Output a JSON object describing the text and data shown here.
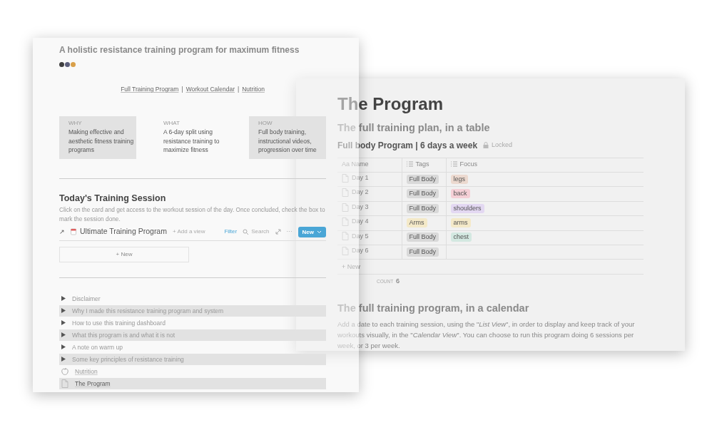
{
  "program_page": {
    "title": "The Program",
    "table_heading": "The full training plan, in a table",
    "database": {
      "title": "Full body Program | 6 days a week",
      "lock": "Locked",
      "columns": [
        {
          "label": "Aa Name",
          "kind": "text"
        },
        {
          "label": "Tags",
          "kind": "list"
        },
        {
          "label": "Focus",
          "kind": "list"
        }
      ],
      "rows": [
        {
          "name": "Day 1",
          "tags": [
            {
              "label": "Full Body",
              "color": "#d9d9d9"
            }
          ],
          "focus": [
            {
              "label": "legs",
              "color": "#ecd9cf"
            }
          ]
        },
        {
          "name": "Day 2",
          "tags": [
            {
              "label": "Full Body",
              "color": "#d9d9d9"
            }
          ],
          "focus": [
            {
              "label": "back",
              "color": "#f5cfd6"
            }
          ]
        },
        {
          "name": "Day 3",
          "tags": [
            {
              "label": "Full Body",
              "color": "#d9d9d9"
            }
          ],
          "focus": [
            {
              "label": "shoulders",
              "color": "#e3d8f2"
            }
          ]
        },
        {
          "name": "Day 4",
          "tags": [
            {
              "label": "Arms",
              "color": "#f4e9c8"
            }
          ],
          "focus": [
            {
              "label": "arms",
              "color": "#f4e9c8"
            }
          ]
        },
        {
          "name": "Day 5",
          "tags": [
            {
              "label": "Full Body",
              "color": "#d9d9d9"
            }
          ],
          "focus": [
            {
              "label": "chest",
              "color": "#d3e8e1"
            }
          ]
        },
        {
          "name": "Day 6",
          "tags": [
            {
              "label": "Full Body",
              "color": "#d9d9d9"
            }
          ],
          "focus": []
        }
      ],
      "new_row": "+ New",
      "count_label": "COUNT",
      "count": "6"
    },
    "calendar_heading": "The full training program, in a calendar",
    "calendar_text": "Add a date to each training session, using the \"*List View*\", in order to display and keep track of your workouts visually, in the \"*Calendar View*\". You can choose to run this program doing 6 sessions per week, or 3 per week."
  },
  "dashboard_page": {
    "subtitle": "A holistic resistance training program for maximum fitness",
    "dots": [
      {
        "color": "#3f3f3f"
      },
      {
        "color": "#5b5e7a"
      },
      {
        "color": "#d9a04a"
      }
    ],
    "links": [
      "Full Training Program",
      "Workout Calendar",
      "Nutrition"
    ],
    "link_separator": "|",
    "columns": [
      {
        "heading": "WHY",
        "text": "Making effective and aesthetic fitness training programs",
        "shaded": true
      },
      {
        "heading": "WHAT",
        "text": "A 6-day split using resistance training to maximize fitness",
        "shaded": false
      },
      {
        "heading": "HOW",
        "text": "Full body training, instructional videos, progression over time",
        "shaded": true
      }
    ],
    "session_heading": "Today's Training Session",
    "session_text": "Click on the card and get access to the workout session of the day. Once concluded, check the box to mark the session done.",
    "view": {
      "arrow": "↗",
      "title": "Ultimate Training Program",
      "add_view": "+ Add a view",
      "filter": "Filter",
      "search": "Search",
      "more": "···",
      "new_button": "New",
      "new_card": "+ New"
    },
    "toggles": [
      {
        "kind": "toggle",
        "label": "Disclaimer",
        "highlighted": false
      },
      {
        "kind": "toggle",
        "label": "Why I made this resistance training program and system",
        "highlighted": true
      },
      {
        "kind": "toggle",
        "label": "How to use this training dashboard",
        "highlighted": false
      },
      {
        "kind": "toggle",
        "label": "What this program is and what it is not",
        "highlighted": true
      },
      {
        "kind": "toggle",
        "label": "A note on warm up",
        "highlighted": false
      },
      {
        "kind": "toggle",
        "label": "Some key principles of resistance training",
        "highlighted": true
      },
      {
        "kind": "apple_page",
        "label": "Nutrition",
        "highlighted": false
      },
      {
        "kind": "doc_page",
        "label": "The Program",
        "highlighted": true
      }
    ]
  }
}
